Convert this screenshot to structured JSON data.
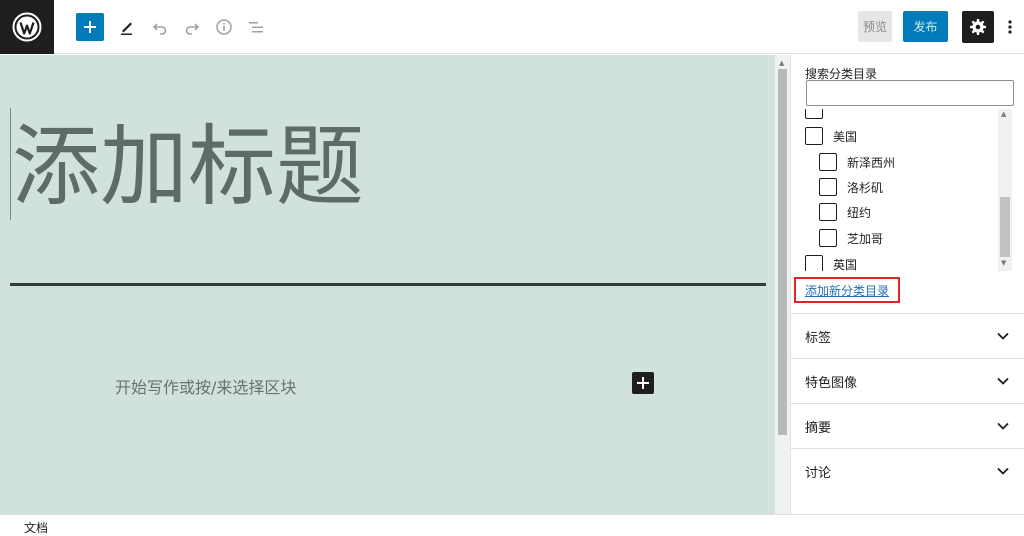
{
  "toolbar": {
    "logo_icon": "wordpress-logo-icon",
    "add_block_icon": "plus-icon",
    "tools": [
      {
        "name": "pencil-icon"
      },
      {
        "name": "undo-icon"
      },
      {
        "name": "redo-icon"
      },
      {
        "name": "info-icon"
      },
      {
        "name": "list-view-icon"
      }
    ],
    "preview_label": "预览",
    "publish_label": "发布",
    "settings_icon": "gear-icon",
    "more_icon": "more-vertical-icon",
    "accent_color": "#007cba"
  },
  "editor": {
    "title_placeholder": "添加标题",
    "block_placeholder": "开始写作或按/来选择区块",
    "background_color": "#d1e2dd"
  },
  "sidebar": {
    "categories": {
      "search_label": "搜索分类目录",
      "search_value": "",
      "items": [
        {
          "label": "美国",
          "checked": false
        },
        {
          "label": "新泽西州",
          "checked": false
        },
        {
          "label": "洛杉矶",
          "checked": false
        },
        {
          "label": "纽约",
          "checked": false
        },
        {
          "label": "芝加哥",
          "checked": false
        },
        {
          "label": "英国",
          "checked": false
        }
      ],
      "add_new_label": "添加新分类目录"
    },
    "panels": [
      {
        "title": "标签"
      },
      {
        "title": "特色图像"
      },
      {
        "title": "摘要"
      },
      {
        "title": "讨论"
      }
    ]
  },
  "footer": {
    "breadcrumb": "文档"
  }
}
